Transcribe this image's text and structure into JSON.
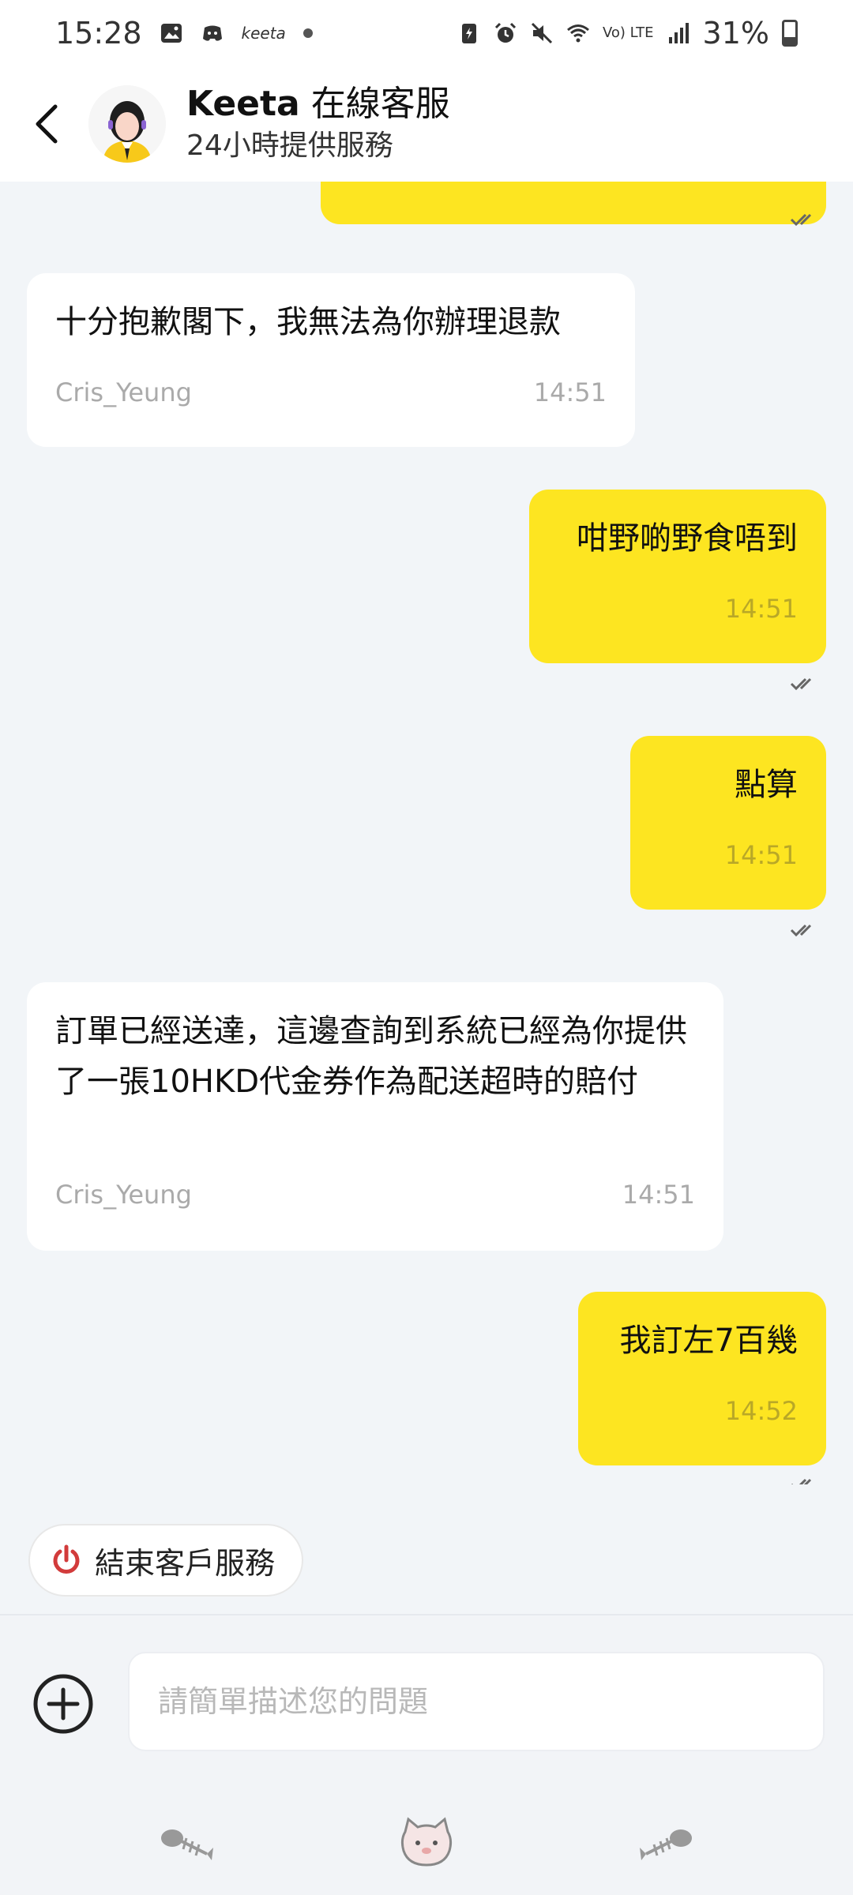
{
  "status_bar": {
    "time": "15:28",
    "app_mini": "keeta",
    "battery": "31%",
    "network": "Vo) LTE"
  },
  "header": {
    "brand": "Keeta",
    "title_suffix": " 在線客服",
    "subtitle": "24小時提供服務"
  },
  "messages": [
    {
      "dir": "in",
      "text": "十分抱歉閣下，我無法為你辦理退款",
      "sender": "Cris_Yeung",
      "time": "14:51"
    },
    {
      "dir": "out",
      "text": "咁野啲野食唔到",
      "time": "14:51"
    },
    {
      "dir": "out",
      "text": "點算",
      "time": "14:51"
    },
    {
      "dir": "in",
      "text": "訂單已經送達，這邊查詢到系統已經為你提供了一張10HKD代金券作為配送超時的賠付",
      "sender": "Cris_Yeung",
      "time": "14:51"
    },
    {
      "dir": "out",
      "text": "我訂左7百幾",
      "time": "14:52"
    }
  ],
  "end_service_button": {
    "label": "結束客戶服務"
  },
  "composer": {
    "placeholder": "請簡單描述您的問題"
  },
  "colors": {
    "accent_yellow": "#fde521",
    "background": "#f2f5f8",
    "end_icon_red": "#d23b3b"
  }
}
